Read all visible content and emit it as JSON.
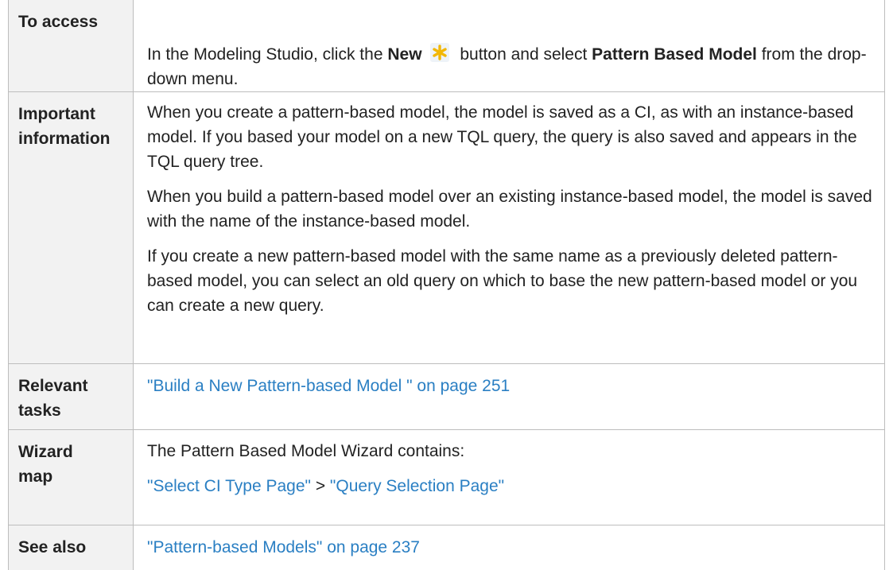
{
  "rows": {
    "access": {
      "label": "To access",
      "p1_pre": "In the Modeling Studio, click the ",
      "p1_new": "New",
      "p1_mid": " button and select ",
      "p1_bold": "Pattern Based Model",
      "p1_post": " from the drop-down menu."
    },
    "important": {
      "label_line1": "Important",
      "label_line2": "information",
      "para1": "When you create a pattern-based model, the model is saved as a CI, as with an instance-based model. If you based your model on a new TQL query, the query is also saved and appears in the TQL query tree.",
      "para2": "When you build a pattern-based model over an existing instance-based model, the model is saved with the name of the instance-based model.",
      "para3": "If you create a new pattern-based model with the same name as a previously deleted pattern-based model, you can select an old query on which to base the new pattern-based model or you can create a new query."
    },
    "relevant": {
      "label_line1": "Relevant",
      "label_line2": "tasks",
      "link": "\"Build a New Pattern-based Model \" on page 251"
    },
    "wizard": {
      "label_line1": "Wizard",
      "label_line2": "map",
      "intro": "The Pattern Based Model Wizard contains:",
      "link1": "\"Select CI Type Page\"",
      "separator": " > ",
      "link2": "\"Query Selection Page\""
    },
    "see_also": {
      "label": "See also",
      "link": "\"Pattern-based Models\" on page 237"
    }
  },
  "icons": {
    "new_button_icon": "asterisk-star-icon"
  },
  "colors": {
    "link": "#2a7fc3",
    "label_bg": "#f2f2f2",
    "border": "#bdbdbd",
    "icon_star": "#f2b705"
  }
}
